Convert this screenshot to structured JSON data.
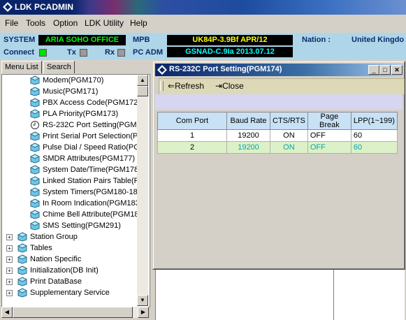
{
  "app": {
    "title": "LDK PCADMIN"
  },
  "menu": [
    "File",
    "Tools",
    "Option",
    "LDK Utility",
    "Help"
  ],
  "status": {
    "system_label": "SYSTEM",
    "system_value": "ARIA SOHO OFFICE",
    "mpb_label": "MPB",
    "mpb_value": "UK84P-3.9Bf APR/12",
    "nation_label": "Nation :",
    "nation_value": "United Kingdo",
    "connect_label": "Connect",
    "tx_label": "Tx",
    "rx_label": "Rx",
    "pcadm_label": "PC ADM",
    "pcadm_value": "GSNAD-C.9Ia 2013.07.12",
    "colors": {
      "system_fg": "#00ff00",
      "mpb_fg": "#ffff00",
      "pcadm_fg": "#00ffff"
    }
  },
  "left_tabs": [
    "Menu List",
    "Search"
  ],
  "tree_items": [
    "Modem(PGM170)",
    "Music(PGM171)",
    "PBX Access Code(PGM172)",
    "PLA Priority(PGM173)",
    "RS-232C Port Setting(PGM1",
    "Print Serial Port Selection(P",
    "Pulse Dial / Speed Ratio(PGI",
    "SMDR Attributes(PGM177)",
    "System Date/Time(PGM178",
    "Linked Station Pairs Table(P",
    "System Timers(PGM180-182",
    "In Room Indication(PGM183",
    "Chime Bell Attribute(PGM18",
    "SMS Setting(PGM291)"
  ],
  "tree_groups": [
    "Station Group",
    "Tables",
    "Nation Specific",
    "Initialization(DB Init)",
    "Print DataBase",
    "Supplementary Service"
  ],
  "child": {
    "title": "RS-232C Port Setting(PGM174)",
    "refresh_label": "Refresh",
    "close_label": "Close",
    "columns": [
      "Com Port",
      "Baud Rate",
      "CTS/RTS",
      "Page Break",
      "LPP(1~199)"
    ],
    "rows": [
      [
        "1",
        "19200",
        "ON",
        "OFF",
        "60"
      ],
      [
        "2",
        "19200",
        "ON",
        "OFF",
        "60"
      ]
    ]
  }
}
